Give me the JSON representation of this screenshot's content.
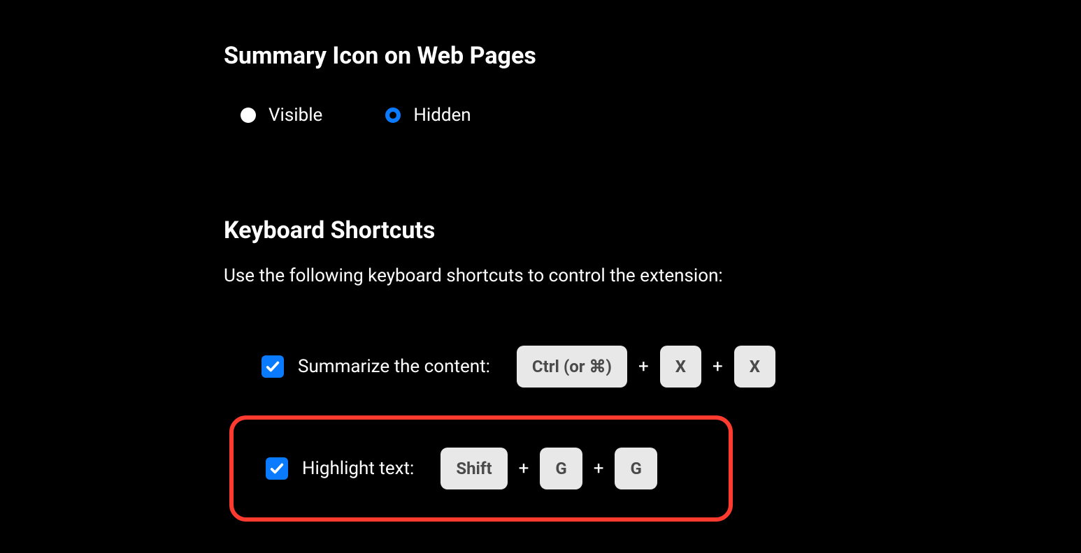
{
  "summary_icon": {
    "title": "Summary Icon on Web Pages",
    "options": {
      "visible": "Visible",
      "hidden": "Hidden"
    },
    "selected": "hidden"
  },
  "shortcuts": {
    "title": "Keyboard Shortcuts",
    "description": "Use the following keyboard shortcuts to control the extension:",
    "items": [
      {
        "label": "Summarize the content:",
        "checked": true,
        "keys": [
          "Ctrl (or ⌘)",
          "X",
          "X"
        ]
      },
      {
        "label": "Highlight text:",
        "checked": true,
        "keys": [
          "Shift",
          "G",
          "G"
        ]
      }
    ],
    "plus": "+"
  }
}
